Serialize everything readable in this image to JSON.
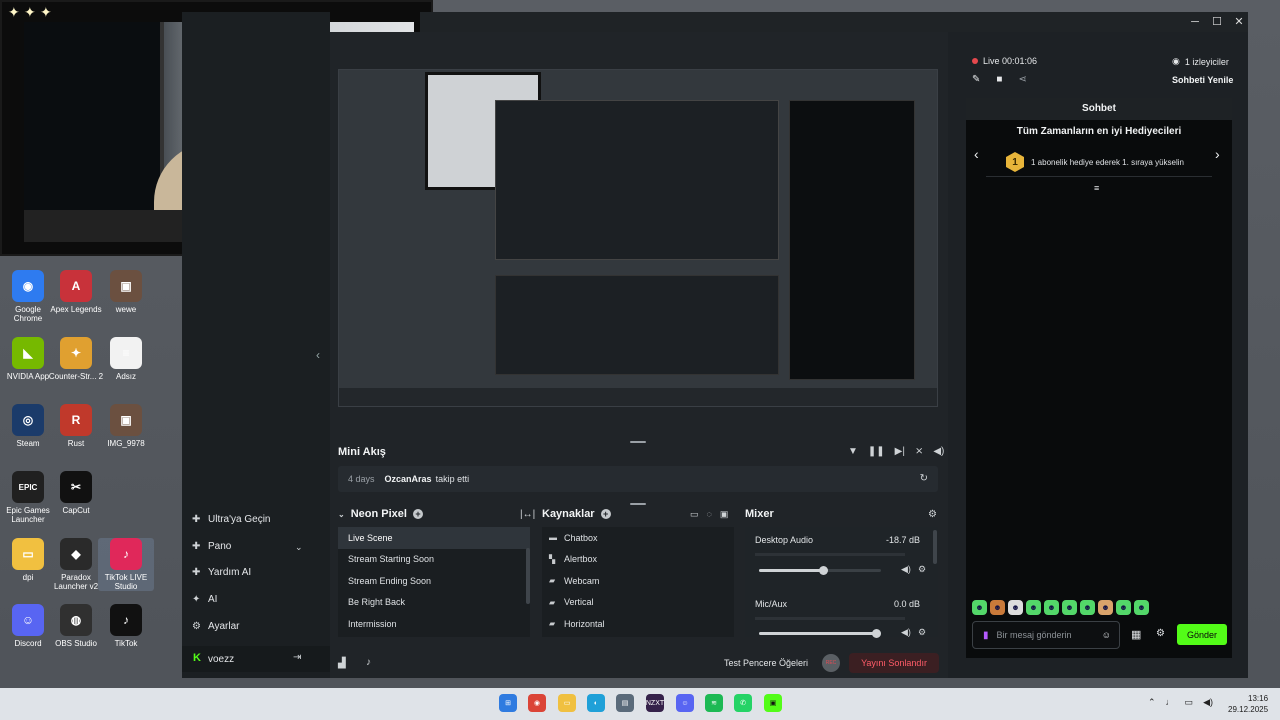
{
  "desktop": {
    "icons": [
      {
        "label": "Google Chrome",
        "color": "#2e7bf0",
        "glyph": "◉"
      },
      {
        "label": "Apex Legends",
        "color": "#c8323a",
        "glyph": "A"
      },
      {
        "label": "wewe",
        "color": "#6b5040",
        "glyph": "▣"
      },
      {
        "label": "NVIDIA App",
        "color": "#76b900",
        "glyph": "◣"
      },
      {
        "label": "Counter-Str... 2",
        "color": "#e0a030",
        "glyph": "✦"
      },
      {
        "label": "Adsız",
        "color": "#f2f2f2",
        "glyph": "≡"
      },
      {
        "label": "Steam",
        "color": "#1b3b6a",
        "glyph": "◎"
      },
      {
        "label": "Rust",
        "color": "#c0392b",
        "glyph": "R"
      },
      {
        "label": "IMG_9978",
        "color": "#6b5040",
        "glyph": "▣"
      },
      {
        "label": "Epic Games Launcher",
        "color": "#202020",
        "glyph": "EPIC"
      },
      {
        "label": "CapCut",
        "color": "#111111",
        "glyph": "✂"
      },
      {
        "label": "dpi",
        "color": "#f1c040",
        "glyph": "▭"
      },
      {
        "label": "Paradox Launcher v2",
        "color": "#2a2a2a",
        "glyph": "◆"
      },
      {
        "label": "TikTok LIVE Studio",
        "color": "#e0285a",
        "glyph": "♪"
      },
      {
        "label": "Discord",
        "color": "#5865f2",
        "glyph": "☺"
      },
      {
        "label": "OBS Studio",
        "color": "#303030",
        "glyph": "◍"
      },
      {
        "label": "TikTok",
        "color": "#111111",
        "glyph": "♪"
      }
    ]
  },
  "sidebar": {
    "items": [
      {
        "icon": "ultra-icon",
        "glyph": "✚",
        "label": "Ultra'ya Geçin"
      },
      {
        "icon": "dashboard-icon",
        "glyph": "✚",
        "label": "Pano"
      },
      {
        "icon": "help-icon",
        "glyph": "✚",
        "label": "Yardım AI"
      },
      {
        "icon": "ai-icon",
        "glyph": "✦",
        "label": "AI"
      },
      {
        "icon": "settings-icon",
        "glyph": "⚙",
        "label": "Ayarlar"
      }
    ],
    "account": "voezz"
  },
  "mini_akis": {
    "title": "Mini Akış",
    "row": {
      "time": "4 days",
      "user": "OzcanAras",
      "action": "takip etti"
    }
  },
  "scenes": {
    "title": "Neon Pixel",
    "items": [
      "Live Scene",
      "Stream Starting Soon",
      "Stream Ending Soon",
      "Be Right Back",
      "Intermission"
    ]
  },
  "sources": {
    "title": "Kaynaklar",
    "items": [
      {
        "label": "Chatbox",
        "icon": "chat-icon"
      },
      {
        "label": "Alertbox",
        "icon": "alert-icon"
      },
      {
        "label": "Webcam",
        "icon": "folder-icon"
      },
      {
        "label": "Vertical",
        "icon": "folder-icon"
      },
      {
        "label": "Horizontal",
        "icon": "folder-icon"
      }
    ]
  },
  "mixer": {
    "title": "Mixer",
    "channels": [
      {
        "name": "Desktop Audio",
        "db": "-18.7 dB",
        "level": 0.53
      },
      {
        "name": "Mic/Aux",
        "db": "0.0 dB",
        "level": 1.0
      }
    ]
  },
  "bottom": {
    "test_label": "Test Pencere Öğeleri",
    "rec_label": "REC",
    "end_button": "Yayını Sonlandır"
  },
  "chat": {
    "live_time": "Live 00:01:06",
    "viewers": "1 izleyiciler",
    "refresh": "Sohbeti Yenile",
    "header": "Sohbet",
    "gifters_title": "Tüm Zamanların en iyi Hediyecileri",
    "gifter_rank": "1",
    "gifter_text": "1 abonelik hediye ederek 1. sıraya yükselin",
    "input_placeholder": "Bir mesaj gönderin",
    "send": "Gönder"
  },
  "taskbar": {
    "time": "13:16",
    "date": "29.12.2025"
  },
  "colors": {
    "accent": "#53fc18",
    "danger": "#ff5c68",
    "live": "#e5484d"
  }
}
